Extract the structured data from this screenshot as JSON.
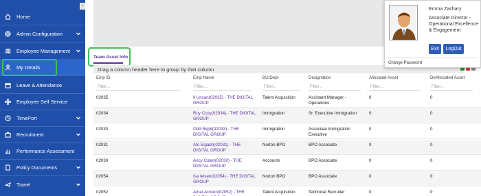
{
  "sidebar": {
    "collapse_icon": "‹",
    "items": [
      {
        "label": "Home",
        "icon": "home-icon",
        "chevron": false
      },
      {
        "label": "Admin Configuration",
        "icon": "gear-icon",
        "chevron": true
      },
      {
        "label": "Employee Management",
        "icon": "user-group-icon",
        "chevron": true
      },
      {
        "label": "My Details",
        "icon": "person-icon",
        "chevron": false
      },
      {
        "label": "Leave & Attendance",
        "icon": "calendar-icon",
        "chevron": false
      },
      {
        "label": "Employee Self Service",
        "icon": "network-icon",
        "chevron": false
      },
      {
        "label": "TimePort",
        "icon": "clock-icon",
        "chevron": true
      },
      {
        "label": "Recruitment",
        "icon": "briefcase-icon",
        "chevron": true
      },
      {
        "label": "Performance Assessment",
        "icon": "chart-icon",
        "chevron": false
      },
      {
        "label": "Policy Documents",
        "icon": "document-icon",
        "chevron": true
      },
      {
        "label": "Travel",
        "icon": "plane-icon",
        "chevron": true
      }
    ],
    "active_index": 3,
    "highlight_color": "#3bc15a"
  },
  "main": {
    "tab_label": "Team Asset Info",
    "group_hint": "Drag a column header here to group by that column",
    "columns": [
      "Emp ID",
      "Emp Name",
      "BU/Dept",
      "Designation",
      "Allocated Asset",
      "DeAllocated Asset"
    ],
    "filter_placeholder": "Filter...",
    "rows": [
      {
        "id": "02035",
        "name": "Il Uncan(02035) - THE DIGITAL GROUP",
        "dept": "Talent Acquisition",
        "designation": "Assistant Manager - Operations",
        "allocated": "0",
        "deallocated": "0"
      },
      {
        "id": "02034",
        "name": "Roy Ccoy(02034) - THE DIGITAL GROUP",
        "dept": "Immigration",
        "designation": "Sr. Executive Immigration",
        "allocated": "0",
        "deallocated": "0"
      },
      {
        "id": "02033",
        "name": "Odd Right(02033) - THE DIGITAL GROUP",
        "dept": "Immigration",
        "designation": "Associate Immigration Executive",
        "allocated": "0",
        "deallocated": "0"
      },
      {
        "id": "02031",
        "name": "Ato Elgado(02031) - THE DIGITAL GROUP",
        "dept": "Norton BPO",
        "designation": "BPO Associate",
        "allocated": "0",
        "deallocated": "0"
      },
      {
        "id": "02030",
        "name": "Ancy Colan(02030) - THE DIGITAL GROUP",
        "dept": "Accounts",
        "designation": "BPO Associate",
        "allocated": "0",
        "deallocated": "0"
      },
      {
        "id": "02054",
        "name": "Isa Ielsen(02054) - THE DIGITAL GROUP",
        "dept": "Norton BPO",
        "designation": "BPO Associate",
        "allocated": "0",
        "deallocated": "0"
      },
      {
        "id": "02052",
        "name": "Amar Arrison(02052) - THE DIGITAL GROUP",
        "dept": "Talent Acquisition",
        "designation": "Technical Recruiter",
        "allocated": "0",
        "deallocated": "0"
      }
    ]
  },
  "profile": {
    "name": "Emma Zachary",
    "role": "Associate Director - Operational Excellence & Engagement",
    "exit_label": "Exit",
    "logout_label": "LogOut",
    "change_password_label": "Change Password"
  },
  "colors": {
    "sidebar_bg": "#1f4fa8",
    "accent_purple": "#5b2f9e",
    "button_blue": "#2f5fb3"
  }
}
